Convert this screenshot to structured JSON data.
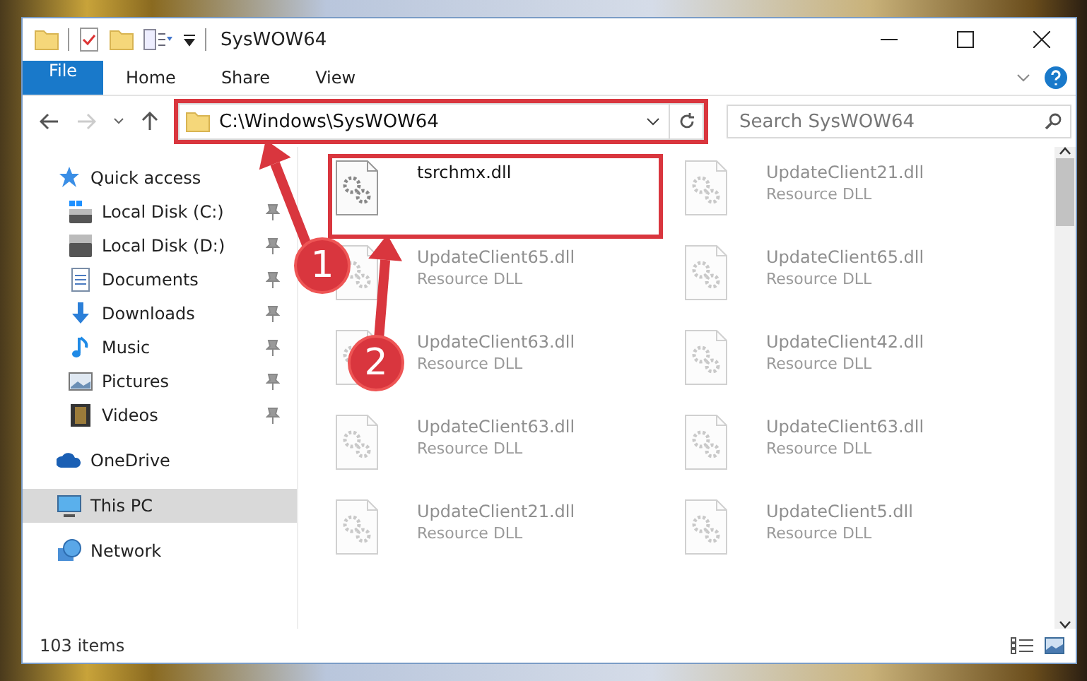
{
  "window": {
    "title": "SysWOW64"
  },
  "ribbon": {
    "tabs": [
      {
        "label": "File",
        "kind": "file"
      },
      {
        "label": "Home",
        "kind": "tab"
      },
      {
        "label": "Share",
        "kind": "tab"
      },
      {
        "label": "View",
        "kind": "tab"
      }
    ]
  },
  "address_bar": {
    "path": "C:\\Windows\\SysWOW64",
    "highlighted": true
  },
  "search": {
    "placeholder": "Search SysWOW64"
  },
  "navigation_pane": {
    "items": [
      {
        "label": "Quick access",
        "kind": "star",
        "selected": false,
        "children": [
          {
            "label": "Local Disk (C:)",
            "kind": "system-drive",
            "pinned": true,
            "selected": false
          },
          {
            "label": "Local Disk (D:)",
            "kind": "drive",
            "pinned": true,
            "selected": false
          },
          {
            "label": "Documents",
            "kind": "document",
            "pinned": true,
            "selected": false
          },
          {
            "label": "Downloads",
            "kind": "download",
            "pinned": true,
            "selected": false
          },
          {
            "label": "Music",
            "kind": "music",
            "pinned": true,
            "selected": false
          },
          {
            "label": "Pictures",
            "kind": "picture",
            "pinned": true,
            "selected": false
          },
          {
            "label": "Videos",
            "kind": "video",
            "pinned": true,
            "selected": false
          }
        ]
      },
      {
        "label": "OneDrive",
        "kind": "cloud",
        "selected": false
      },
      {
        "label": "This PC",
        "kind": "computer",
        "selected": true
      },
      {
        "label": "Network",
        "kind": "network",
        "selected": false
      }
    ]
  },
  "files": [
    {
      "name": "tsrchmx.dll",
      "highlighted": true,
      "faded": false
    },
    {
      "name": "UpdateClient21.dll",
      "type": "Resource DLL",
      "highlighted": false,
      "faded": true
    },
    {
      "name": "UpdateClient65.dll",
      "type": "Resource DLL",
      "highlighted": false,
      "faded": true
    },
    {
      "name": "UpdateClient65.dll",
      "type": "Resource DLL",
      "highlighted": false,
      "faded": true
    },
    {
      "name": "UpdateClient63.dll",
      "type": "Resource DLL",
      "highlighted": false,
      "faded": true
    },
    {
      "name": "UpdateClient42.dll",
      "type": "Resource DLL",
      "highlighted": false,
      "faded": true
    },
    {
      "name": "UpdateClient63.dll",
      "type": "Resource DLL",
      "highlighted": false,
      "faded": true
    },
    {
      "name": "UpdateClient63.dll",
      "type": "Resource DLL",
      "highlighted": false,
      "faded": true
    },
    {
      "name": "UpdateClient21.dll",
      "type": "Resource DLL",
      "highlighted": false,
      "faded": true
    },
    {
      "name": "UpdateClient5.dll",
      "type": "Resource DLL",
      "highlighted": false,
      "faded": true
    }
  ],
  "callouts": [
    {
      "label": "1"
    },
    {
      "label": "2"
    }
  ],
  "status_bar": {
    "item_count": "103 items"
  }
}
